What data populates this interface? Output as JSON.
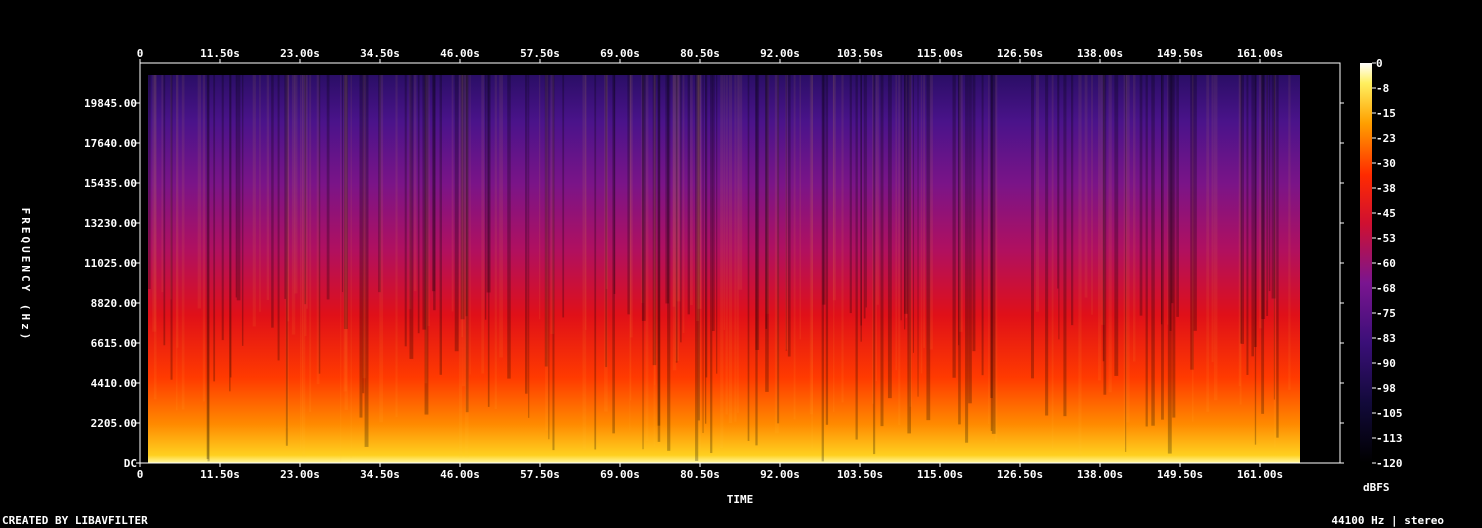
{
  "chart_data": {
    "type": "heatmap",
    "xlabel": "TIME",
    "ylabel": "FREQUENCY (Hz)",
    "x_ticks": [
      "0",
      "11.50s",
      "23.00s",
      "34.50s",
      "46.00s",
      "57.50s",
      "69.00s",
      "80.50s",
      "92.00s",
      "103.50s",
      "115.00s",
      "126.50s",
      "138.00s",
      "149.50s",
      "161.00s"
    ],
    "y_ticks": [
      "DC",
      "2205.00",
      "4410.00",
      "6615.00",
      "8820.00",
      "11025.00",
      "13230.00",
      "15435.00",
      "17640.00",
      "19845.00"
    ],
    "xlim": [
      0,
      172.5
    ],
    "ylim": [
      0,
      22050
    ],
    "colorbar": {
      "label": "dBFS",
      "ticks": [
        "0",
        "-8",
        "-15",
        "-23",
        "-30",
        "-38",
        "-45",
        "-53",
        "-60",
        "-68",
        "-75",
        "-83",
        "-90",
        "-98",
        "-105",
        "-113",
        "-120"
      ],
      "range": [
        -120,
        0
      ]
    }
  },
  "footer": {
    "left": "CREATED BY LIBAVFILTER",
    "right": "44100 Hz | stereo"
  }
}
